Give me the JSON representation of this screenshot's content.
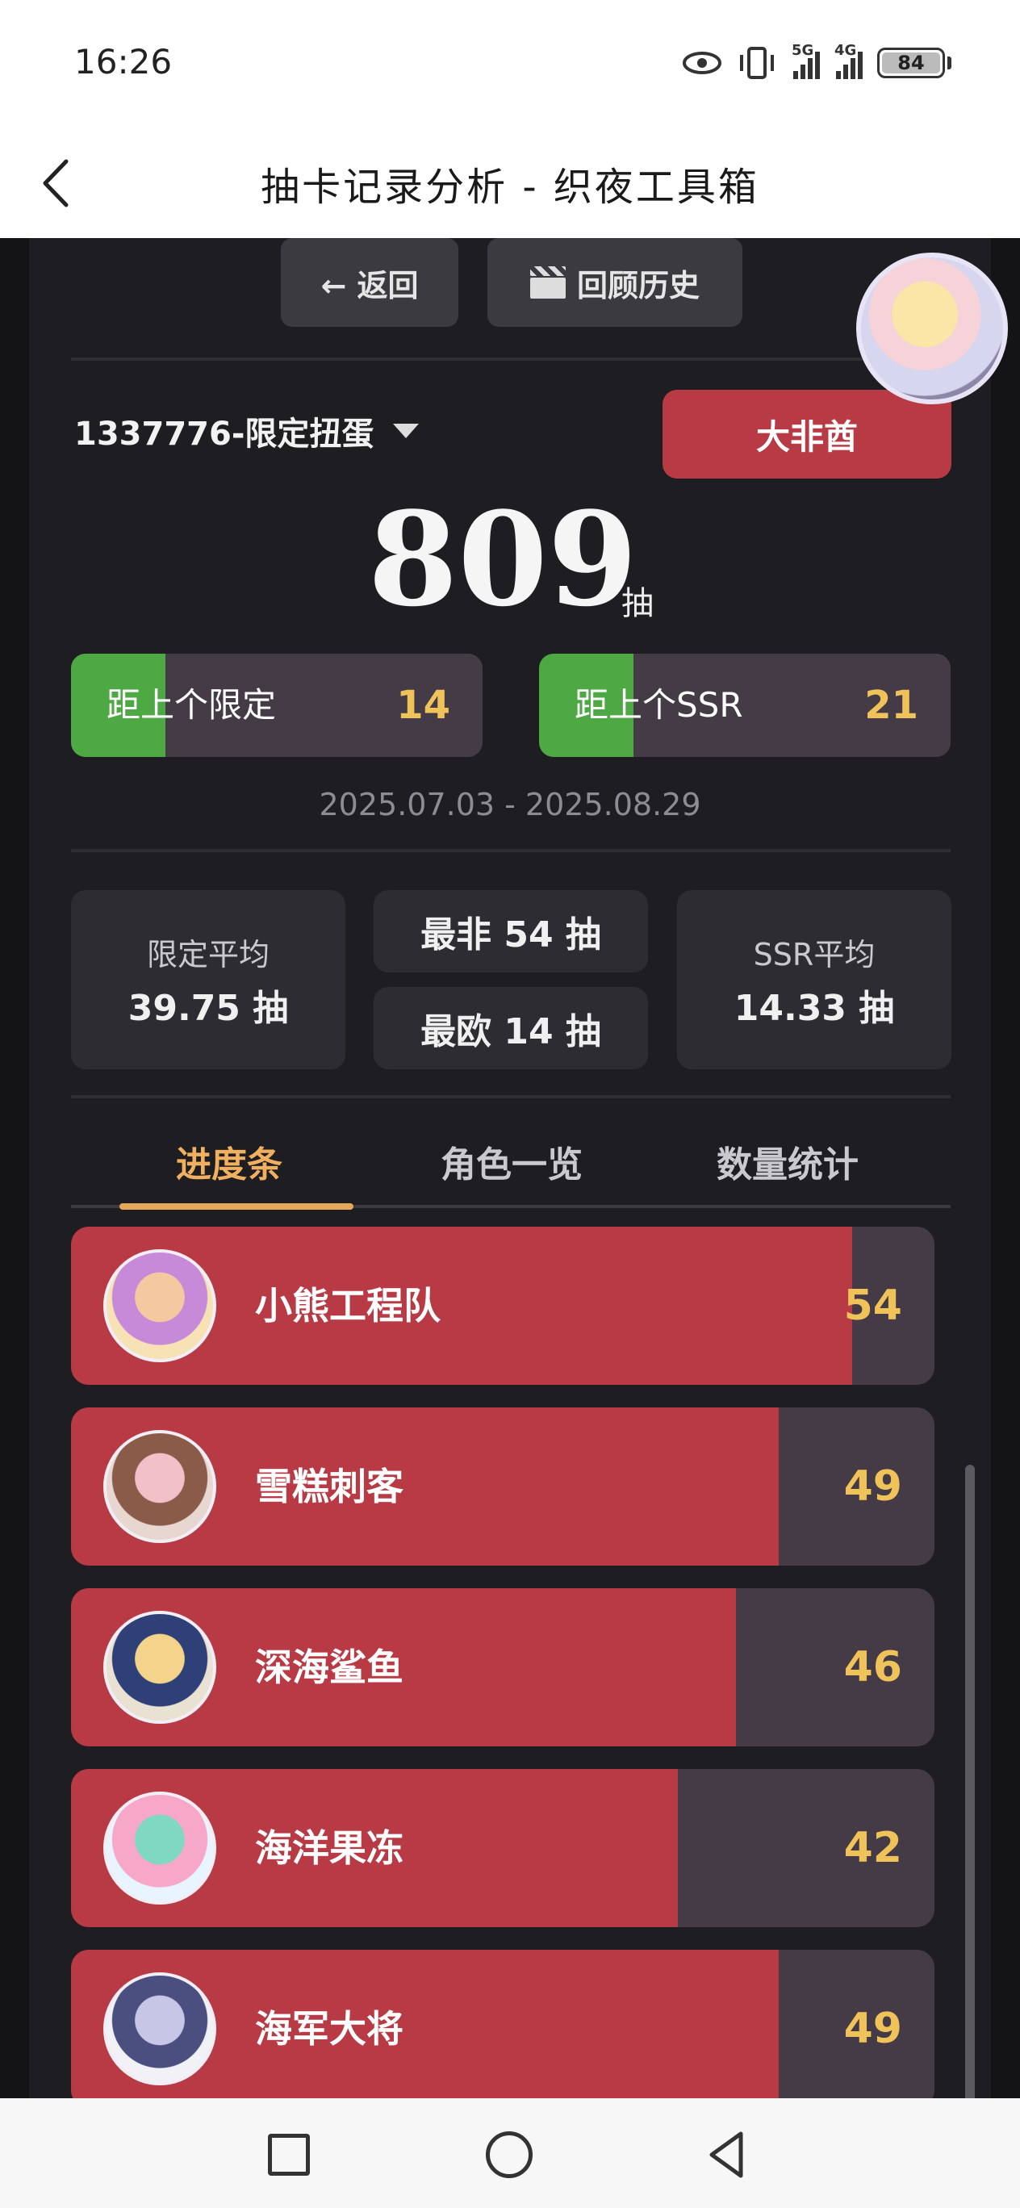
{
  "status_bar": {
    "time": "16:26",
    "icons": [
      "eye-icon",
      "vibrate-icon",
      "signal-5g-icon",
      "signal-4g-icon",
      "battery-icon"
    ],
    "net1": "5G",
    "net2": "4G",
    "battery": "84"
  },
  "header": {
    "title": "抽卡记录分析 - 织夜工具箱",
    "back_icon": "chevron-left-icon"
  },
  "toolbar": {
    "back_label": "← 返回",
    "history_label": "回顾历史"
  },
  "summary": {
    "pool": "1337776-限定扭蛋",
    "rank": "大非酋",
    "total": "809",
    "total_unit": "抽",
    "since_limited_label": "距上个限定",
    "since_limited": "14",
    "since_limited_frac": 0.23,
    "since_ssr_label": "距上个SSR",
    "since_ssr": "21",
    "since_ssr_frac": 0.23,
    "date_range": "2025.07.03 - 2025.08.29"
  },
  "stats": {
    "limited_avg_label": "限定平均",
    "limited_avg": "39.75 抽",
    "worst": "最非 54 抽",
    "best": "最欧 14 抽",
    "ssr_avg_label": "SSR平均",
    "ssr_avg": "14.33 抽"
  },
  "tabs": [
    {
      "label": "进度条",
      "active": true
    },
    {
      "label": "角色一览",
      "active": false
    },
    {
      "label": "数量统计",
      "active": false
    }
  ],
  "pulls": [
    {
      "name": "小熊工程队",
      "count": "54",
      "frac": 0.905,
      "colors": [
        "#f4c9a0",
        "#c78ad8",
        "#f6e2b4"
      ]
    },
    {
      "name": "雪糕刺客",
      "count": "49",
      "frac": 0.82,
      "colors": [
        "#f1c0c8",
        "#8b5b4a",
        "#e8d6d0"
      ]
    },
    {
      "name": "深海鲨鱼",
      "count": "46",
      "frac": 0.77,
      "colors": [
        "#f3d48a",
        "#2f3f78",
        "#e9e2d2"
      ]
    },
    {
      "name": "海洋果冻",
      "count": "42",
      "frac": 0.703,
      "colors": [
        "#7fd8c2",
        "#f7a8c8",
        "#e8f4ff"
      ]
    },
    {
      "name": "海军大将",
      "count": "49",
      "frac": 0.82,
      "colors": [
        "#c8c6e6",
        "#4b4f80",
        "#f2f2f6"
      ]
    }
  ]
}
